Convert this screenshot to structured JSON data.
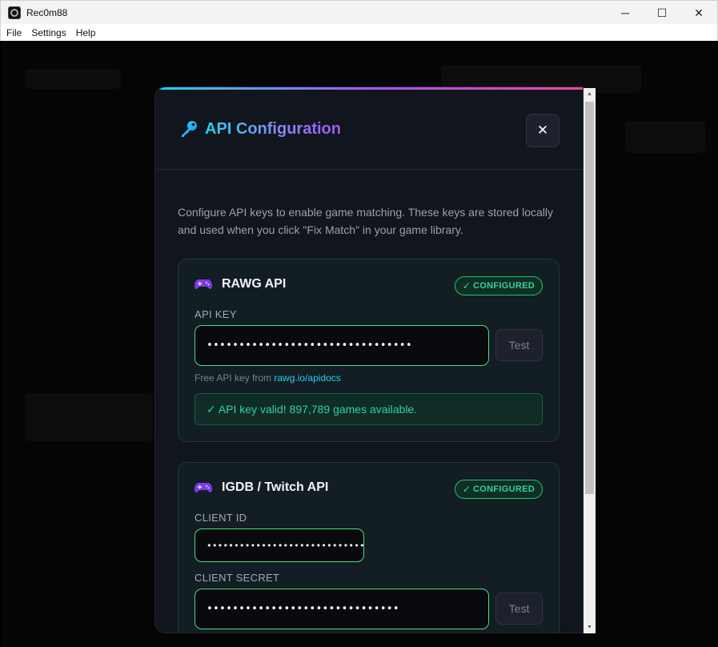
{
  "window": {
    "title": "Rec0m88",
    "minimize_glyph": "─",
    "maximize_glyph": "☐",
    "close_glyph": "✕"
  },
  "menu": [
    "File",
    "Settings",
    "Help"
  ],
  "modal": {
    "title": "API Configuration",
    "title_icon": "key-icon",
    "close_label": "✕",
    "description": "Configure API keys to enable game matching. These keys are stored locally and used when you click \"Fix Match\" in your game library.",
    "accent_colors": [
      "#22d3ee",
      "#a855f7",
      "#ec4899"
    ]
  },
  "rawg": {
    "icon": "gamepad-icon",
    "title": "RAWG API",
    "badge": "CONFIGURED",
    "badge_check": "✓",
    "key_label": "API KEY",
    "key_value": "••••••••••••••••••••••••••••••••",
    "test_label": "Test",
    "hint_prefix": "Free API key from ",
    "hint_link": "rawg.io/apidocs",
    "success_message": "✓ API key valid! 897,789 games available."
  },
  "igdb": {
    "icon": "gamepad-icon",
    "title": "IGDB / Twitch API",
    "badge": "CONFIGURED",
    "badge_check": "✓",
    "client_id_label": "CLIENT ID",
    "client_id_value": "••••••••••••••••••••••••••••••",
    "client_secret_label": "CLIENT SECRET",
    "client_secret_value": "••••••••••••••••••••••••••••••",
    "test_label": "Test"
  },
  "colors": {
    "success": "#34d399",
    "input_border": "#4ade80",
    "link": "#22d3ee"
  }
}
